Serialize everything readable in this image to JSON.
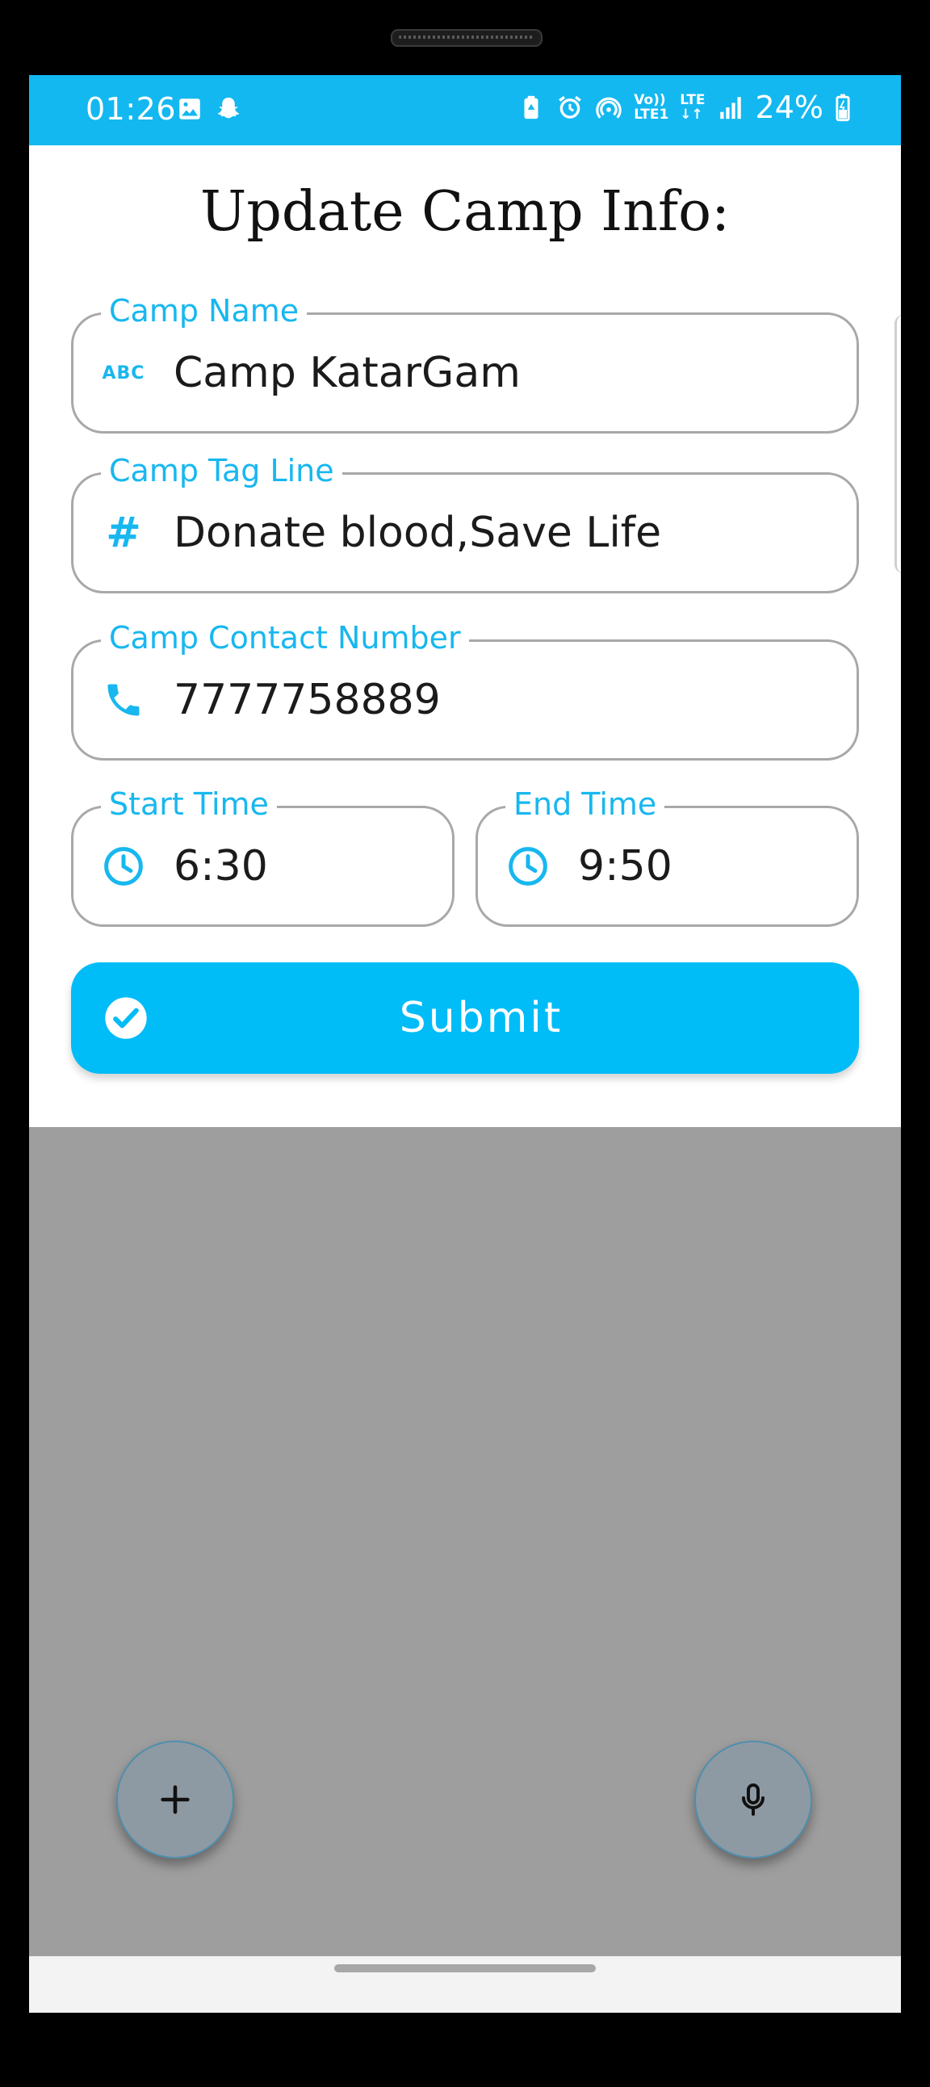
{
  "status_bar": {
    "time": "01:26",
    "network_top": "Vo))",
    "network_bottom": "LTE1",
    "lte_label": "LTE",
    "battery": "24%",
    "background": "#13b8f0"
  },
  "form": {
    "title": "Update Camp Info:",
    "camp_name": {
      "label": "Camp Name",
      "value": "Camp KatarGam",
      "icon": "abc-text-icon",
      "icon_text": "ABC"
    },
    "tag_line": {
      "label": "Camp Tag Line",
      "value": "Donate blood,Save Life",
      "icon": "hash-icon",
      "icon_text": "#"
    },
    "contact": {
      "label": "Camp Contact Number",
      "value": "7777758889",
      "icon": "phone-icon"
    },
    "start_time": {
      "label": "Start Time",
      "value": "6:30",
      "icon": "clock-icon"
    },
    "end_time": {
      "label": "End Time",
      "value": "9:50",
      "icon": "clock-icon"
    },
    "submit_label": "Submit",
    "accent": "#18b7ef"
  },
  "fabs": {
    "add": "plus-icon",
    "voice": "microphone-icon"
  }
}
